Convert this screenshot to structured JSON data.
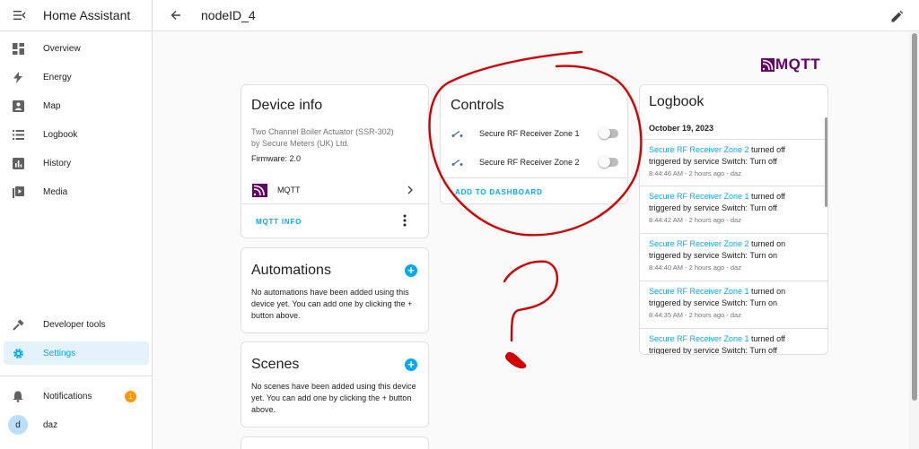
{
  "sidebar": {
    "title": "Home Assistant",
    "items": [
      {
        "label": "Overview"
      },
      {
        "label": "Energy"
      },
      {
        "label": "Map"
      },
      {
        "label": "Logbook"
      },
      {
        "label": "History"
      },
      {
        "label": "Media"
      }
    ],
    "developer_tools": "Developer tools",
    "settings": "Settings",
    "notifications": "Notifications",
    "notifications_count": "1",
    "user_initial": "d",
    "user_name": "daz"
  },
  "topbar": {
    "title": "nodeID_4"
  },
  "brand": {
    "mqtt_logo_text": "MQTT",
    "accent": "#03a9f4",
    "mqtt_color": "#660066"
  },
  "device_info": {
    "title": "Device info",
    "model": "Two Channel Boiler Actuator (SSR-302)",
    "manufacturer": "by Secure Meters (UK) Ltd.",
    "firmware": "Firmware: 2.0",
    "integration": "MQTT",
    "mqtt_info_button": "MQTT INFO"
  },
  "automations": {
    "title": "Automations",
    "text": "No automations have been added using this device yet. You can add one by clicking the + button above."
  },
  "scenes": {
    "title": "Scenes",
    "text": "No scenes have been added using this device yet. You can add one by clicking the + button above."
  },
  "controls": {
    "title": "Controls",
    "items": [
      {
        "label": "Secure RF Receiver Zone 1",
        "state": "off"
      },
      {
        "label": "Secure RF Receiver Zone 2",
        "state": "off"
      }
    ],
    "add_to_dashboard": "ADD TO DASHBOARD"
  },
  "logbook": {
    "title": "Logbook",
    "date": "October 19, 2023",
    "entries": [
      {
        "entity": "Secure RF Receiver Zone 2",
        "action": " turned off",
        "trigger": "triggered by service Switch: Turn off",
        "meta": "8:44:46 AM - 2 hours ago - daz"
      },
      {
        "entity": "Secure RF Receiver Zone 1",
        "action": " turned off",
        "trigger": "triggered by service Switch: Turn off",
        "meta": "8:44:42 AM - 2 hours ago - daz"
      },
      {
        "entity": "Secure RF Receiver Zone 2",
        "action": " turned on",
        "trigger": "triggered by service Switch: Turn on",
        "meta": "8:44:40 AM - 2 hours ago - daz"
      },
      {
        "entity": "Secure RF Receiver Zone 1",
        "action": " turned on",
        "trigger": "triggered by service Switch: Turn on",
        "meta": "8:44:35 AM - 2 hours ago - daz"
      },
      {
        "entity": "Secure RF Receiver Zone 1",
        "action": " turned off",
        "trigger": "triggered by service Switch: Turn off",
        "meta": ""
      }
    ]
  }
}
